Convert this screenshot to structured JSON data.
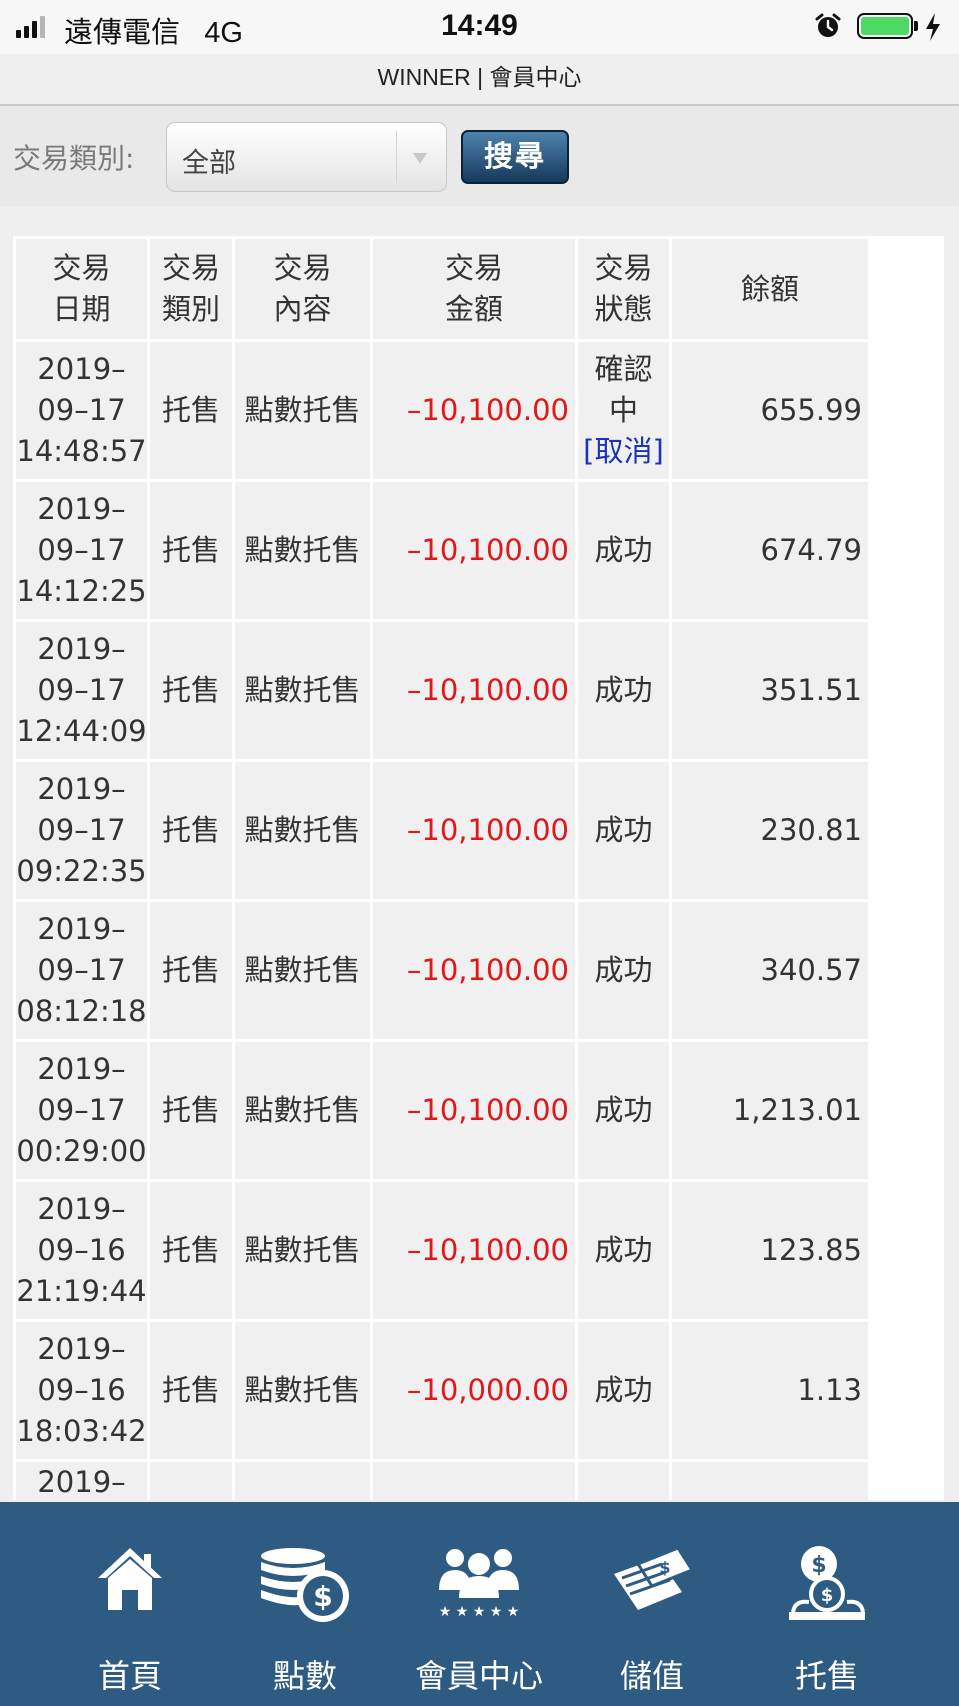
{
  "status_bar": {
    "carrier": "遠傳電信",
    "network": "4G",
    "time": "14:49",
    "battery_level": 1.0
  },
  "header": {
    "title": "WINNER | 會員中心"
  },
  "filter": {
    "label": "交易類別:",
    "selected": "全部",
    "search_label": "搜尋"
  },
  "table": {
    "headers": {
      "date": [
        "交易",
        "日期"
      ],
      "type": [
        "交易",
        "類別"
      ],
      "content": [
        "交易",
        "內容"
      ],
      "amount": [
        "交易",
        "金額"
      ],
      "status": [
        "交易",
        "狀態"
      ],
      "balance": "餘額"
    },
    "rows": [
      {
        "date": [
          "2019–",
          "09–17",
          "14:48:57"
        ],
        "type": "托售",
        "content": "點數托售",
        "amount": "–10,100.00",
        "status": [
          "確認",
          "中"
        ],
        "action": "[取消]",
        "balance": "655.99"
      },
      {
        "date": [
          "2019–",
          "09–17",
          "14:12:25"
        ],
        "type": "托售",
        "content": "點數托售",
        "amount": "–10,100.00",
        "status": [
          "成功"
        ],
        "balance": "674.79"
      },
      {
        "date": [
          "2019–",
          "09–17",
          "12:44:09"
        ],
        "type": "托售",
        "content": "點數托售",
        "amount": "–10,100.00",
        "status": [
          "成功"
        ],
        "balance": "351.51"
      },
      {
        "date": [
          "2019–",
          "09–17",
          "09:22:35"
        ],
        "type": "托售",
        "content": "點數托售",
        "amount": "–10,100.00",
        "status": [
          "成功"
        ],
        "balance": "230.81"
      },
      {
        "date": [
          "2019–",
          "09–17",
          "08:12:18"
        ],
        "type": "托售",
        "content": "點數托售",
        "amount": "–10,100.00",
        "status": [
          "成功"
        ],
        "balance": "340.57"
      },
      {
        "date": [
          "2019–",
          "09–17",
          "00:29:00"
        ],
        "type": "托售",
        "content": "點數托售",
        "amount": "–10,100.00",
        "status": [
          "成功"
        ],
        "balance": "1,213.01"
      },
      {
        "date": [
          "2019–",
          "09–16",
          "21:19:44"
        ],
        "type": "托售",
        "content": "點數托售",
        "amount": "–10,100.00",
        "status": [
          "成功"
        ],
        "balance": "123.85"
      },
      {
        "date": [
          "2019–",
          "09–16",
          "18:03:42"
        ],
        "type": "托售",
        "content": "點數托售",
        "amount": "–10,000.00",
        "status": [
          "成功"
        ],
        "balance": "1.13"
      }
    ],
    "partial_row_date": "2019–"
  },
  "bottom_nav": [
    {
      "label": "首頁",
      "icon": "home-icon"
    },
    {
      "label": "點數",
      "icon": "coins-icon"
    },
    {
      "label": "會員中心",
      "icon": "members-icon"
    },
    {
      "label": "儲值",
      "icon": "deposit-icon"
    },
    {
      "label": "托售",
      "icon": "sell-icon"
    }
  ],
  "colors": {
    "nav_background": "#2e5b82",
    "amount_negative": "#e0181b",
    "cancel_link": "#1a33b8",
    "battery": "#4cd964"
  }
}
